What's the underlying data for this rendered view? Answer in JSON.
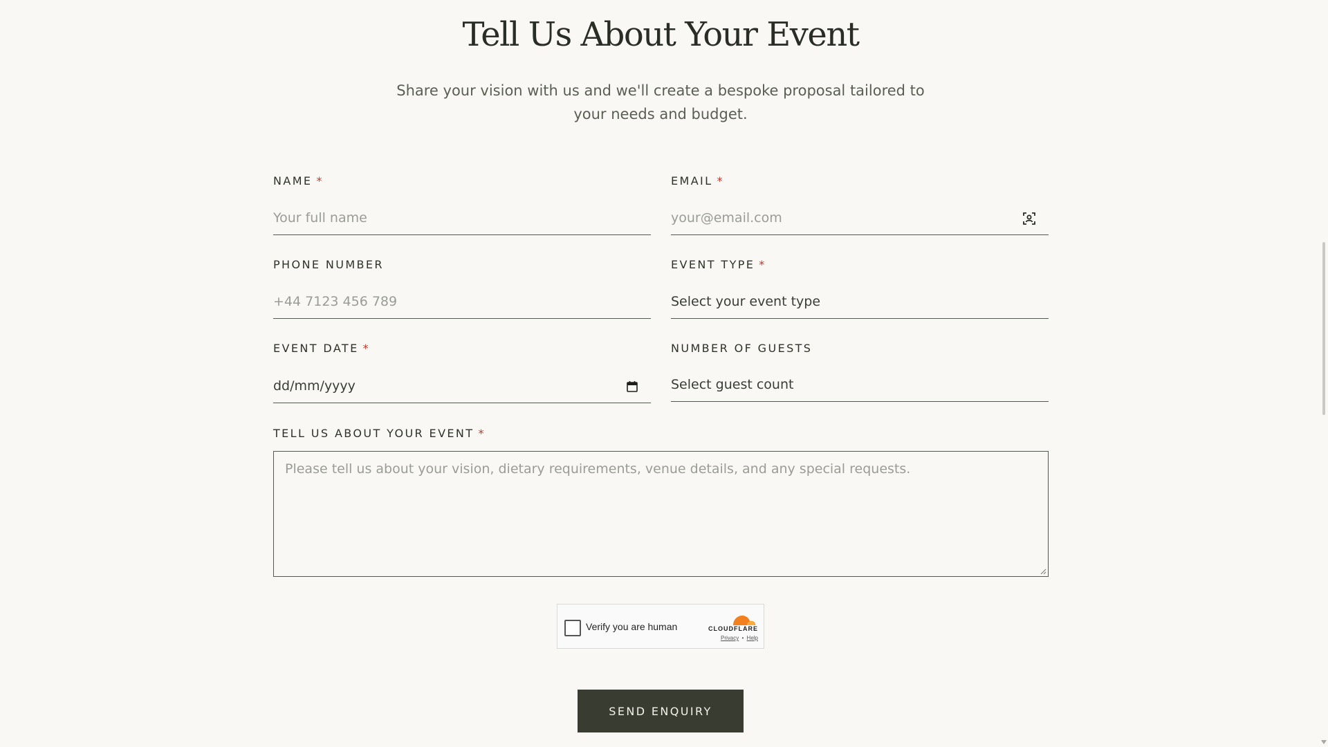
{
  "page": {
    "title": "Tell Us About Your Event",
    "subtitle": "Share your vision with us and we'll create a bespoke proposal tailored to your needs and budget."
  },
  "form": {
    "name": {
      "label": "NAME",
      "required": "*",
      "placeholder": "Your full name"
    },
    "email": {
      "label": "EMAIL",
      "required": "*",
      "placeholder": "your@email.com"
    },
    "phone": {
      "label": "PHONE NUMBER",
      "placeholder": "+44 7123 456 789"
    },
    "event_type": {
      "label": "EVENT TYPE",
      "required": "*",
      "value": "Select your event type"
    },
    "event_date": {
      "label": "EVENT DATE",
      "required": "*",
      "value": "dd/mm/yyyy"
    },
    "guests": {
      "label": "NUMBER OF GUESTS",
      "value": "Select guest count"
    },
    "details": {
      "label": "TELL US ABOUT YOUR EVENT",
      "required": "*",
      "placeholder": "Please tell us about your vision, dietary requirements, venue details, and any special requests."
    },
    "submit_label": "SEND ENQUIRY"
  },
  "captcha": {
    "label": "Verify you are human",
    "brand": "CLOUDFLARE",
    "privacy": "Privacy",
    "separator": "•",
    "help": "Help",
    "logo_color": "#f38020"
  },
  "icons": {
    "email_field": "contact-card-icon",
    "date_field": "calendar-icon"
  },
  "colors": {
    "background": "#f9f8f4",
    "button": "#393c30",
    "required": "#c0392b"
  }
}
